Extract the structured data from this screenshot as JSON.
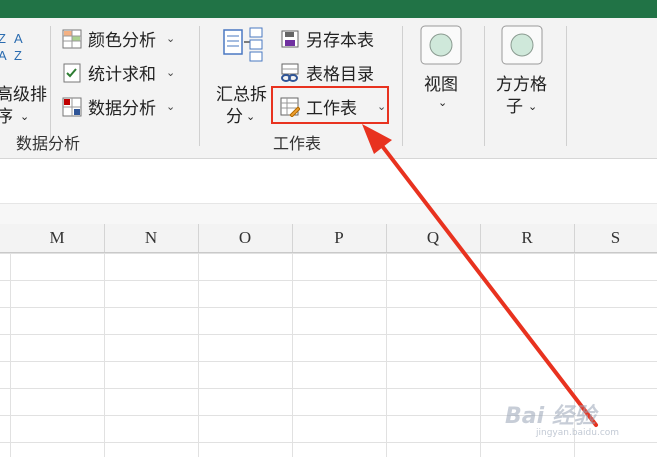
{
  "window": {
    "title_partial": ""
  },
  "ribbon": {
    "sort_group": {
      "label_line1": "高级排",
      "label_line2": "序"
    },
    "data_analysis_group": {
      "items": [
        {
          "label": "颜色分析"
        },
        {
          "label": "统计求和"
        },
        {
          "label": "数据分析"
        }
      ],
      "group_label": "数据分析"
    },
    "worksheet_group": {
      "summary_split": {
        "line1": "汇总拆",
        "line2": "分"
      },
      "items": [
        {
          "label": "另存本表"
        },
        {
          "label": "表格目录"
        },
        {
          "label": "工作表"
        }
      ],
      "group_label": "工作表"
    },
    "view": {
      "label": "视图"
    },
    "fangfang": {
      "line1": "方方格",
      "line2": "子"
    }
  },
  "sheet": {
    "columns": [
      "M",
      "N",
      "O",
      "P",
      "Q",
      "R",
      "S"
    ]
  },
  "annotation": {
    "highlight_color": "#e8321f"
  },
  "watermark": {
    "main": "Bai 经验",
    "sub": "jingyan.baidu.com"
  }
}
